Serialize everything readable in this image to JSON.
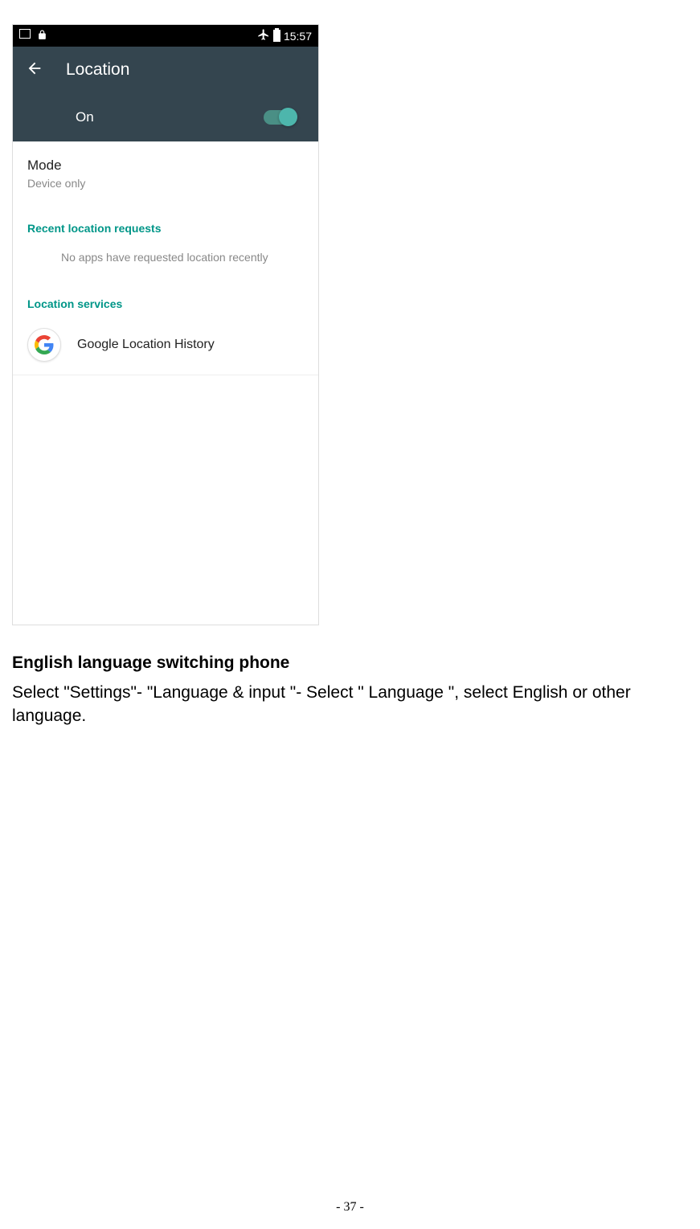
{
  "statusbar": {
    "time": "15:57"
  },
  "appbar": {
    "title": "Location"
  },
  "toggle": {
    "label": "On"
  },
  "mode": {
    "title": "Mode",
    "value": "Device only"
  },
  "sections": {
    "recent_header": "Recent location requests",
    "no_apps": "No apps have requested location recently",
    "services_header": "Location services",
    "service_item": "Google Location History"
  },
  "doc": {
    "heading": "English language switching phone",
    "para": "Select \"Settings\"- \"Language & input \"- Select \" Language \", select English or other language."
  },
  "page_num": "- 37 -"
}
